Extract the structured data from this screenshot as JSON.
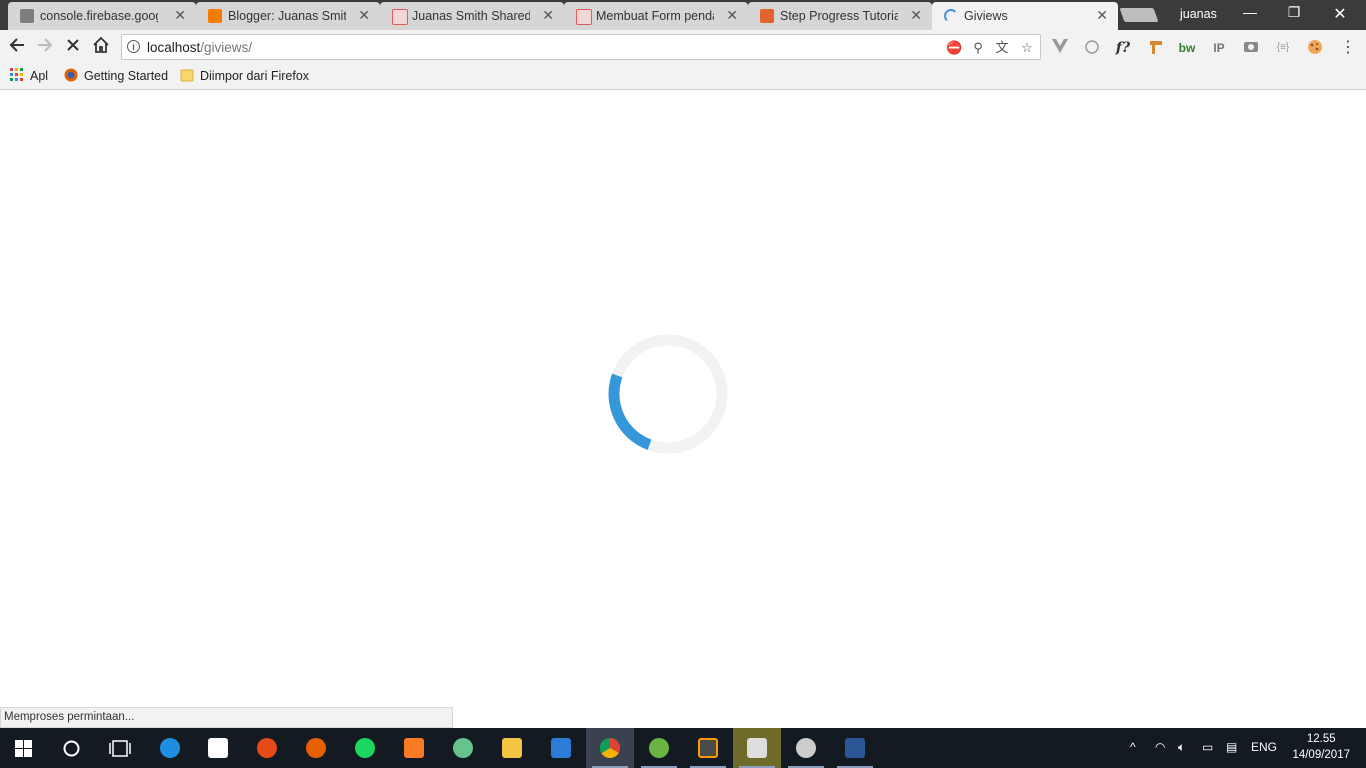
{
  "browser": {
    "tabs": [
      {
        "title": "console.firebase.google.",
        "favicon_color": "#7d7d7d"
      },
      {
        "title": "Blogger: Juanas Smith",
        "favicon_color": "#f57d00"
      },
      {
        "title": "Juanas Smith Shared",
        "favicon_color": "#e05b5b"
      },
      {
        "title": "Membuat Form pendaf",
        "favicon_color": "#e05b5b"
      },
      {
        "title": "Step Progress Tutorial",
        "favicon_color": "#e3632d"
      },
      {
        "title": "Giviews",
        "favicon_color": "#4a90e2"
      }
    ],
    "active_tab": 5,
    "profile_name": "juanas",
    "window_controls": {
      "minimize": "—",
      "restore": "❐",
      "close": "✕"
    }
  },
  "toolbar": {
    "url_host": "localhost",
    "url_path": "/giviews/",
    "back_icon": "arrow-left-icon",
    "forward_icon": "arrow-right-icon",
    "stop_icon": "close-icon",
    "home_icon": "home-icon"
  },
  "bookmarks": [
    {
      "label": "Apl",
      "icon": "apps-grid-icon"
    },
    {
      "label": "Getting Started",
      "icon": "firefox-icon"
    },
    {
      "label": "Diimpor dari Firefox",
      "icon": "folder-icon"
    }
  ],
  "extensions": [
    "vuejs-icon",
    "circle-icon",
    "f?",
    "hammer-icon",
    "bw",
    "IP",
    "camera-icon",
    "{≡}",
    "cookie-icon",
    "menu-dots-icon"
  ],
  "page": {
    "loading_progress": 0.25,
    "spinner_color": "#3498db",
    "spinner_track_color": "#f2f2f2"
  },
  "status_bar": {
    "text": "Memproses permintaan..."
  },
  "taskbar": {
    "apps": [
      {
        "name": "start-button",
        "color": "#ffffff"
      },
      {
        "name": "search-button",
        "color": "#ffffff"
      },
      {
        "name": "task-view-button",
        "color": "#ffffff"
      },
      {
        "name": "edge-app",
        "color": "#1e8fe0"
      },
      {
        "name": "store-app",
        "color": "#ffffff"
      },
      {
        "name": "paint-app",
        "color": "#e64a19"
      },
      {
        "name": "firefox-app",
        "color": "#e66000"
      },
      {
        "name": "spotify-app",
        "color": "#1ed760"
      },
      {
        "name": "xampp-app",
        "color": "#fb7a24"
      },
      {
        "name": "atom-app",
        "color": "#66c38c"
      },
      {
        "name": "file-explorer-app",
        "color": "#f4c542"
      },
      {
        "name": "photo-app",
        "color": "#2c7bd6"
      },
      {
        "name": "chrome-app",
        "color": "#db4437"
      },
      {
        "name": "android-studio-app",
        "color": "#6ab344"
      },
      {
        "name": "sublime-app",
        "color": "#ff9800"
      },
      {
        "name": "movie-maker-app",
        "color": "#dddddd"
      },
      {
        "name": "davinci-app",
        "color": "#cccccc"
      },
      {
        "name": "word-app",
        "color": "#2b5797"
      }
    ],
    "tray_language": "ENG",
    "time": "12.55",
    "date": "14/09/2017"
  }
}
